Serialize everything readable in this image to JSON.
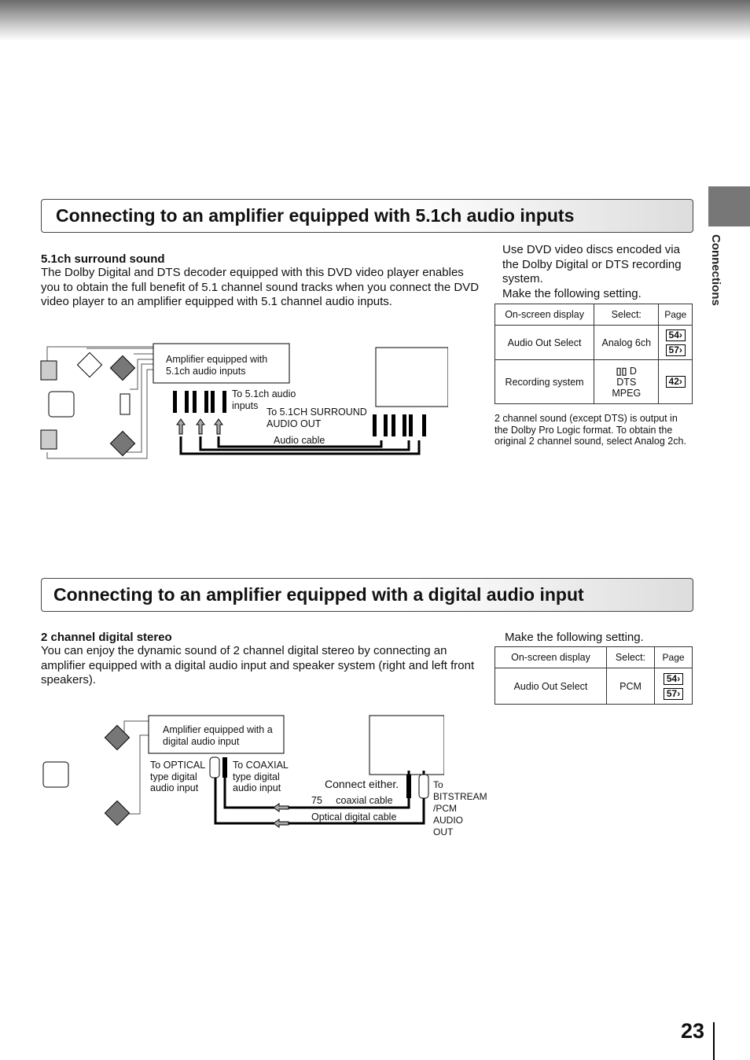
{
  "side_tab": "Connections",
  "page_number": "23",
  "section1": {
    "title": "Connecting to an amplifier equipped with 5.1ch audio inputs",
    "subtitle": "5.1ch surround sound",
    "body": "The Dolby Digital and DTS decoder equipped with this DVD video player enables you to obtain the full benefit of 5.1 channel sound tracks when you connect the DVD video player to an amplifier equipped with 5.1 channel audio inputs.",
    "note": "Use DVD video discs encoded via the Dolby Digital or DTS recording system.",
    "instruction": "Make the following setting.",
    "table": {
      "headers": [
        "On-screen display",
        "Select:",
        "Page"
      ],
      "rows": [
        {
          "display": "Audio Out Select",
          "select": "Analog 6ch",
          "pages": [
            "54",
            "57"
          ]
        },
        {
          "display": "Recording system",
          "select": [
            "D",
            "DTS",
            "MPEG"
          ],
          "pages": [
            "42"
          ]
        }
      ]
    },
    "footnote": "2 channel sound (except DTS) is output in the Dolby Pro Logic format. To obtain the original 2 channel sound, select  Analog 2ch.",
    "diagram": {
      "amp_label": "Amplifier equipped with 5.1ch audio inputs",
      "inputs_label": "To 5.1ch audio inputs",
      "output_label": "To 5.1CH SURROUND AUDIO OUT",
      "cable_label": "Audio cable"
    }
  },
  "section2": {
    "title": "Connecting to an amplifier equipped with a digital audio input",
    "subtitle": "2 channel digital stereo",
    "body": "You can enjoy the dynamic sound of 2 channel digital stereo by connecting an amplifier equipped with a digital audio input and speaker system (right and left front speakers).",
    "instruction": "Make the following setting.",
    "table": {
      "headers": [
        "On-screen display",
        "Select:",
        "Page"
      ],
      "rows": [
        {
          "display": "Audio Out Select",
          "select": "PCM",
          "pages": [
            "54",
            "57"
          ]
        }
      ]
    },
    "diagram": {
      "amp_label": "Amplifier equipped with a digital audio input",
      "optical_label": "To OPTICAL type digital audio input",
      "coaxial_label": "To COAXIAL type digital audio input",
      "connect_either": "Connect either.",
      "coax_cable": "75     coaxial cable",
      "optical_cable": "Optical digital cable",
      "output_label": "To BITSTREAM /PCM AUDIO OUT"
    }
  }
}
